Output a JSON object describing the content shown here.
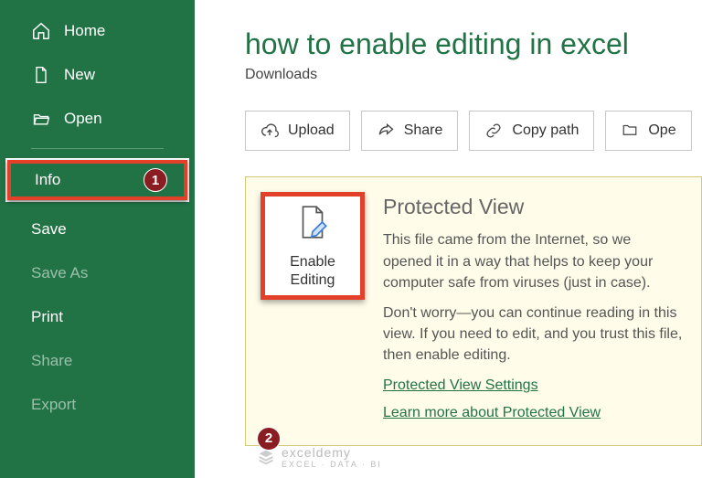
{
  "sidebar": {
    "home": "Home",
    "new": "New",
    "open": "Open",
    "info": "Info",
    "save": "Save",
    "saveAs": "Save As",
    "print": "Print",
    "share": "Share",
    "export": "Export"
  },
  "badges": {
    "one": "1",
    "two": "2"
  },
  "page": {
    "title": "how to enable editing in excel",
    "location": "Downloads"
  },
  "toolbar": {
    "upload": "Upload",
    "share": "Share",
    "copypath": "Copy path",
    "open": "Ope"
  },
  "enable": {
    "label": "Enable Editing"
  },
  "protected": {
    "heading": "Protected View",
    "p1": "This file came from the Internet, so we opened it in a way that helps to keep your computer safe from viruses (just in case).",
    "p2": "Don't worry—you can continue reading in this view. If you need to edit, and you trust this file, then enable editing.",
    "link1": "Protected View Settings",
    "link2": "Learn more about Protected View"
  },
  "watermark": {
    "brand": "exceldemy",
    "tag": "EXCEL · DATA · BI"
  }
}
